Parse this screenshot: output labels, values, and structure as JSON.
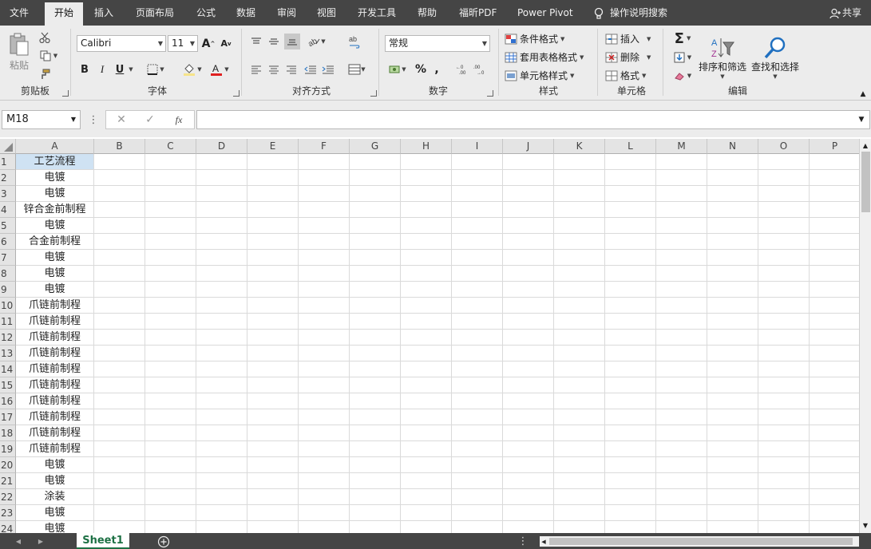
{
  "ribbon_tabs": [
    "文件",
    "开始",
    "插入",
    "页面布局",
    "公式",
    "数据",
    "审阅",
    "视图",
    "开发工具",
    "帮助",
    "福昕PDF",
    "Power Pivot"
  ],
  "tell_me": "操作说明搜索",
  "share": "共享",
  "clipboard": {
    "paste": "粘贴",
    "label": "剪贴板"
  },
  "font": {
    "name": "Calibri",
    "size": "11",
    "bold": "B",
    "italic": "I",
    "underline": "U",
    "label": "字体",
    "grow": "A",
    "shrink": "A"
  },
  "alignment": {
    "label": "对齐方式"
  },
  "number": {
    "format": "常规",
    "percent": "%",
    "comma": ",",
    "label": "数字"
  },
  "styles": {
    "conditional": "条件格式",
    "table": "套用表格格式",
    "cell": "单元格样式",
    "label": "样式"
  },
  "cells": {
    "insert": "插入",
    "delete": "删除",
    "format": "格式",
    "label": "单元格"
  },
  "editing": {
    "sort": "排序和筛选",
    "find": "查找和选择",
    "label": "编辑"
  },
  "name_box": "M18",
  "formula_bar": {
    "fx": "fx",
    "value": ""
  },
  "columns": [
    "A",
    "B",
    "C",
    "D",
    "E",
    "F",
    "G",
    "H",
    "I",
    "J",
    "K",
    "L",
    "M",
    "N",
    "O",
    "P"
  ],
  "rows": [
    {
      "n": "1",
      "a": "工艺流程"
    },
    {
      "n": "2",
      "a": "电镀"
    },
    {
      "n": "3",
      "a": "电镀"
    },
    {
      "n": "4",
      "a": "锌合金前制程"
    },
    {
      "n": "5",
      "a": "电镀"
    },
    {
      "n": "6",
      "a": "合金前制程"
    },
    {
      "n": "7",
      "a": "电镀"
    },
    {
      "n": "8",
      "a": "电镀"
    },
    {
      "n": "9",
      "a": "电镀"
    },
    {
      "n": "10",
      "a": "爪链前制程"
    },
    {
      "n": "11",
      "a": "爪链前制程"
    },
    {
      "n": "12",
      "a": "爪链前制程"
    },
    {
      "n": "13",
      "a": "爪链前制程"
    },
    {
      "n": "14",
      "a": "爪链前制程"
    },
    {
      "n": "15",
      "a": "爪链前制程"
    },
    {
      "n": "16",
      "a": "爪链前制程"
    },
    {
      "n": "17",
      "a": "爪链前制程"
    },
    {
      "n": "18",
      "a": "爪链前制程"
    },
    {
      "n": "19",
      "a": "爪链前制程"
    },
    {
      "n": "20",
      "a": "电镀"
    },
    {
      "n": "21",
      "a": "电镀"
    },
    {
      "n": "22",
      "a": "涂装"
    },
    {
      "n": "23",
      "a": "电镀"
    },
    {
      "n": "24",
      "a": "电镀"
    }
  ],
  "sheet_tabs": [
    "Sheet1"
  ],
  "colors": {
    "chrome": "#454545",
    "ribbon": "#ececec",
    "accent": "#1e7145",
    "selection": "#cfe2f3"
  }
}
